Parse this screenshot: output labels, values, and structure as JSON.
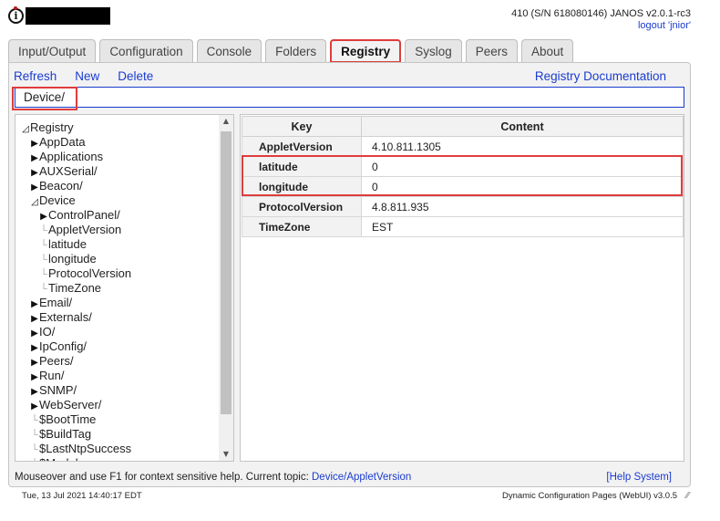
{
  "header": {
    "device_info": "410 (S/N 618080146) JANOS v2.0.1-rc3",
    "logout_label": "logout 'jnior'"
  },
  "tabs": [
    {
      "label": "Input/Output",
      "active": false
    },
    {
      "label": "Configuration",
      "active": false
    },
    {
      "label": "Console",
      "active": false
    },
    {
      "label": "Folders",
      "active": false
    },
    {
      "label": "Registry",
      "active": true
    },
    {
      "label": "Syslog",
      "active": false
    },
    {
      "label": "Peers",
      "active": false
    },
    {
      "label": "About",
      "active": false
    }
  ],
  "toolbar": {
    "refresh_label": "Refresh",
    "new_label": "New",
    "delete_label": "Delete",
    "doc_label": "Registry Documentation"
  },
  "path": {
    "value": "Device/"
  },
  "tree": {
    "root_label": "Registry",
    "items": [
      {
        "label": "AppData",
        "type": "collapsed",
        "depth": 1
      },
      {
        "label": "Applications",
        "type": "collapsed",
        "depth": 1
      },
      {
        "label": "AUXSerial/",
        "type": "collapsed",
        "depth": 1
      },
      {
        "label": "Beacon/",
        "type": "collapsed",
        "depth": 1
      },
      {
        "label": "Device",
        "type": "expanded",
        "depth": 1
      },
      {
        "label": "ControlPanel/",
        "type": "collapsed",
        "depth": 2
      },
      {
        "label": "AppletVersion",
        "type": "leaf",
        "depth": 2
      },
      {
        "label": "latitude",
        "type": "leaf",
        "depth": 2
      },
      {
        "label": "longitude",
        "type": "leaf",
        "depth": 2
      },
      {
        "label": "ProtocolVersion",
        "type": "leaf",
        "depth": 2
      },
      {
        "label": "TimeZone",
        "type": "leaf",
        "depth": 2
      },
      {
        "label": "Email/",
        "type": "collapsed",
        "depth": 1
      },
      {
        "label": "Externals/",
        "type": "collapsed",
        "depth": 1
      },
      {
        "label": "IO/",
        "type": "collapsed",
        "depth": 1
      },
      {
        "label": "IpConfig/",
        "type": "collapsed",
        "depth": 1
      },
      {
        "label": "Peers/",
        "type": "collapsed",
        "depth": 1
      },
      {
        "label": "Run/",
        "type": "collapsed",
        "depth": 1
      },
      {
        "label": "SNMP/",
        "type": "collapsed",
        "depth": 1
      },
      {
        "label": "WebServer/",
        "type": "collapsed",
        "depth": 1
      },
      {
        "label": "$BootTime",
        "type": "leaf",
        "depth": 1
      },
      {
        "label": "$BuildTag",
        "type": "leaf",
        "depth": 1
      },
      {
        "label": "$LastNtpSuccess",
        "type": "leaf",
        "depth": 1
      },
      {
        "label": "$Model",
        "type": "leaf",
        "depth": 1
      }
    ]
  },
  "grid": {
    "headers": [
      "Key",
      "Content"
    ],
    "rows": [
      {
        "key": "AppletVersion",
        "value": "4.10.811.1305"
      },
      {
        "key": "latitude",
        "value": "0"
      },
      {
        "key": "longitude",
        "value": "0"
      },
      {
        "key": "ProtocolVersion",
        "value": "4.8.811.935"
      },
      {
        "key": "TimeZone",
        "value": "EST"
      }
    ]
  },
  "help": {
    "text": "Mouseover and use F1 for context sensitive help. Current topic: ",
    "topic": "Device/AppletVersion",
    "system_label": "[Help System]"
  },
  "footer": {
    "datetime": "Tue, 13 Jul 2021 14:40:17 EDT",
    "version": "Dynamic Configuration Pages (WebUI) v3.0.5"
  },
  "icons": {
    "expand": "triangle-right-icon",
    "collapse": "triangle-down-icon",
    "resize": "resize-grip-icon"
  }
}
